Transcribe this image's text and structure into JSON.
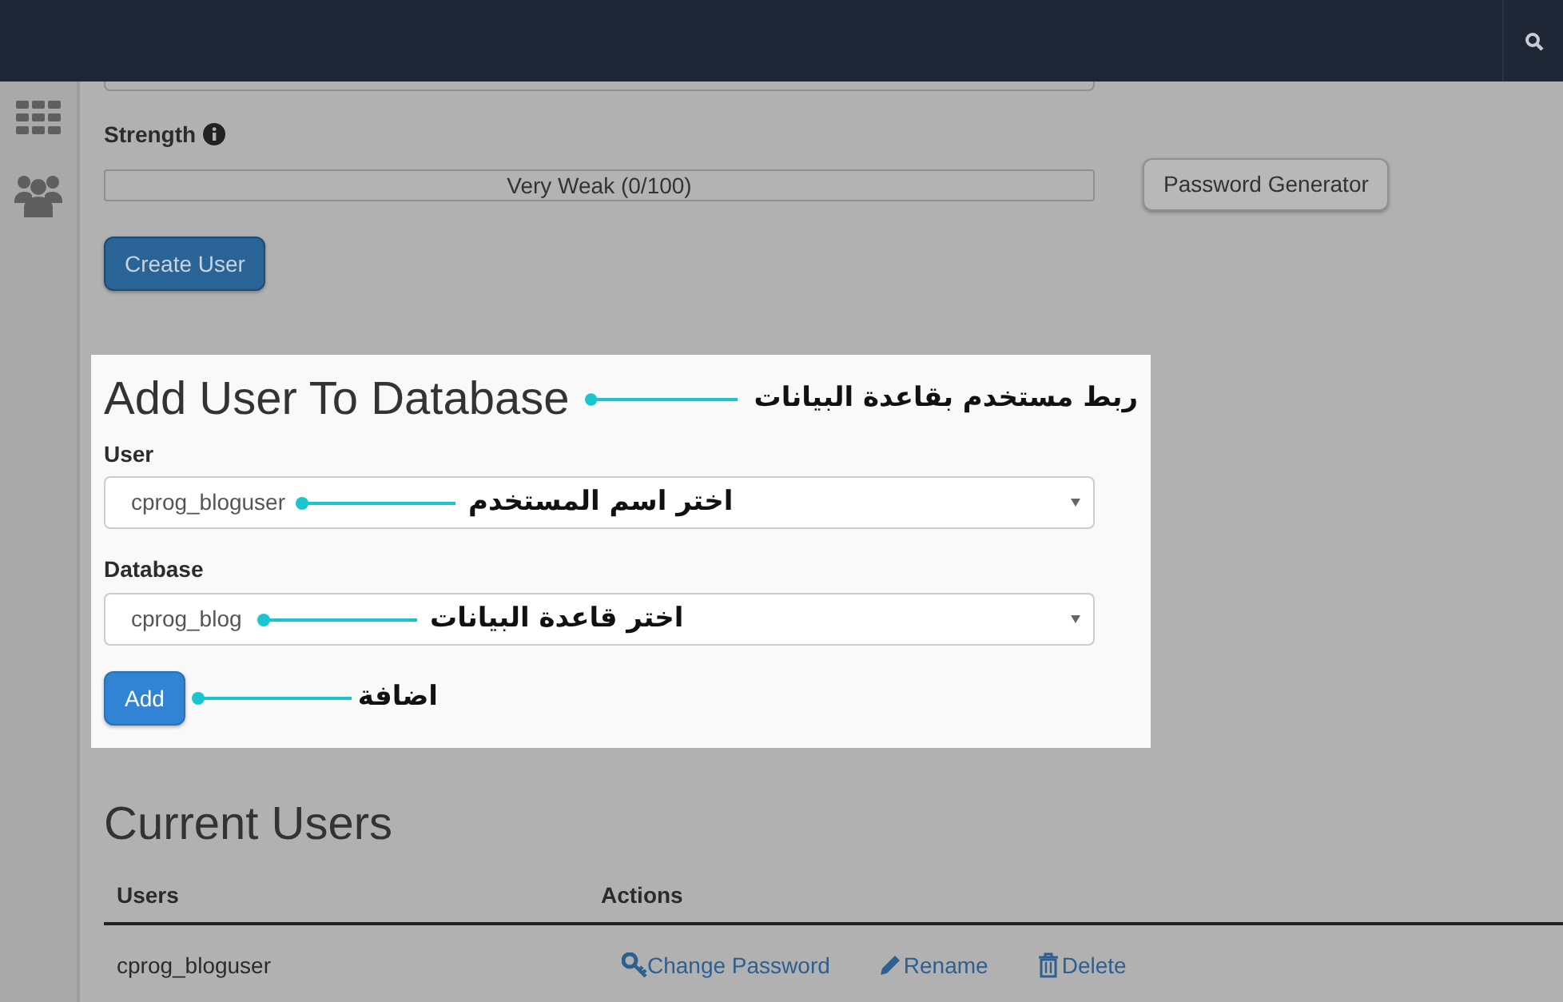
{
  "strength": {
    "label": "Strength",
    "level": 0,
    "reading": "Very Weak (0/100)"
  },
  "password_generator_button": "Password Generator",
  "create_user_button": "Create User",
  "add_user_panel": {
    "title": "Add User To Database",
    "title_callout": "ربط مستخدم بقاعدة البيانات",
    "fields": [
      {
        "label": "User",
        "value": "cprog_bloguser",
        "callout": "اختر اسم المستخدم"
      },
      {
        "label": "Database",
        "value": "cprog_blog",
        "callout": "اختر قاعدة البيانات"
      }
    ],
    "add_button": "Add",
    "add_callout": "اضافة"
  },
  "current_users": {
    "title": "Current Users",
    "columns": [
      "Users",
      "Actions"
    ],
    "rows": [
      {
        "user": "cprog_bloguser",
        "actions": [
          {
            "kind": "password",
            "label": "Change Password"
          },
          {
            "kind": "rename",
            "label": "Rename"
          },
          {
            "kind": "delete",
            "label": "Delete"
          }
        ]
      }
    ]
  }
}
